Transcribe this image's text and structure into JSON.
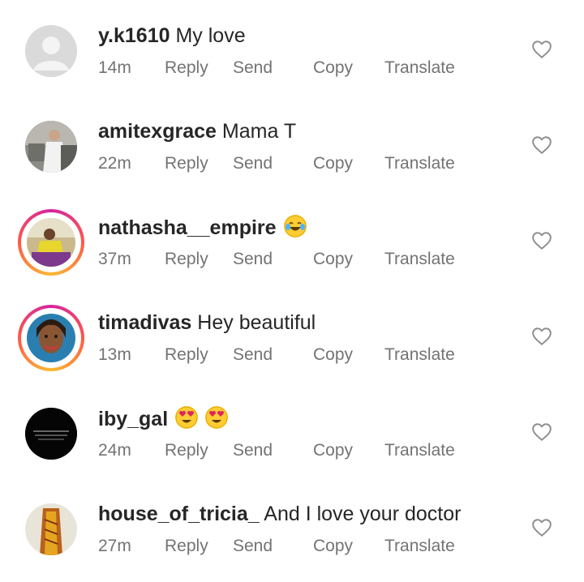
{
  "comments": [
    {
      "username": "y.k1610",
      "text": "My love",
      "time": "14m",
      "reply": "Reply",
      "send": "Send",
      "copy": "Copy",
      "translate": "Translate"
    },
    {
      "username": "amitexgrace",
      "text": "Mama T",
      "time": "22m",
      "reply": "Reply",
      "send": "Send",
      "copy": "Copy",
      "translate": "Translate"
    },
    {
      "username": "nathasha__empire",
      "text": "",
      "emoji": "tears-of-joy",
      "time": "37m",
      "reply": "Reply",
      "send": "Send",
      "copy": "Copy",
      "translate": "Translate"
    },
    {
      "username": "timadivas",
      "text": "Hey beautiful",
      "time": "13m",
      "reply": "Reply",
      "send": "Send",
      "copy": "Copy",
      "translate": "Translate"
    },
    {
      "username": "iby_gal",
      "text": "",
      "emoji": "heart-eyes x2",
      "time": "24m",
      "reply": "Reply",
      "send": "Send",
      "copy": "Copy",
      "translate": "Translate"
    },
    {
      "username": "house_of_tricia_",
      "text": "And I love your doctor",
      "time": "27m",
      "reply": "Reply",
      "send": "Send",
      "copy": "Copy",
      "translate": "Translate"
    }
  ],
  "colors": {
    "primary_text": "#262626",
    "secondary_text": "#737373",
    "story_ring": "#d6249f"
  }
}
